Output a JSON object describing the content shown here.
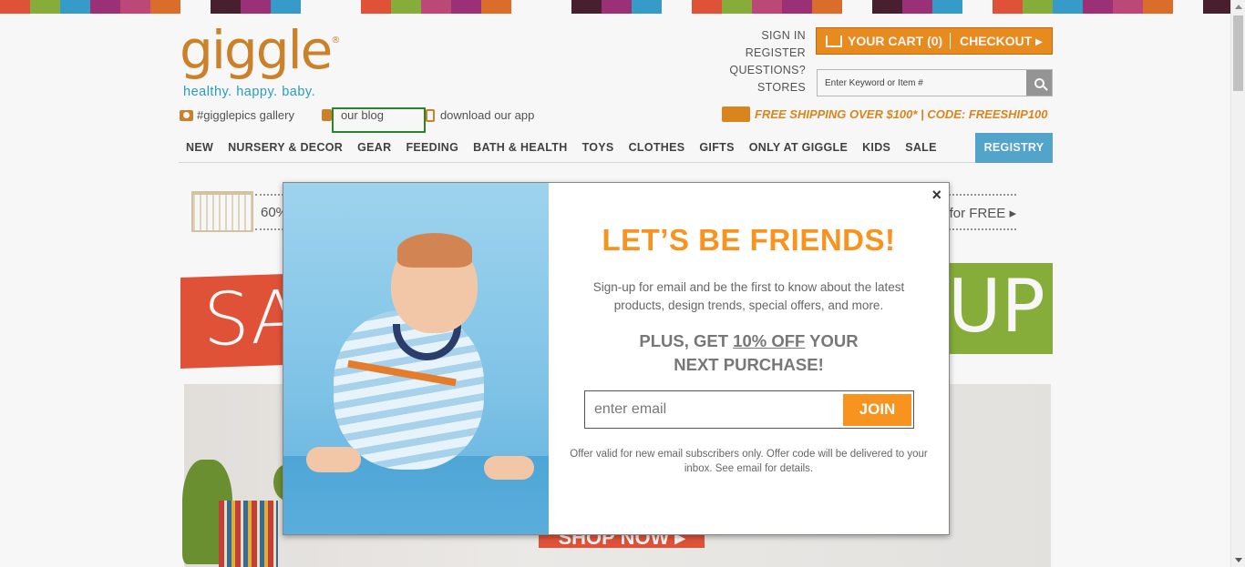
{
  "stripe_colors": [
    "#e8553a",
    "#8bb33b",
    "#38a0cf",
    "#a0327a",
    "#c24b7a",
    "#e0712b",
    "#fff",
    "#4a2030",
    "#a0327a",
    "#38a0cf",
    "#fff",
    "#fff",
    "#e8553a",
    "#8bb33b",
    "#c24b7a",
    "#a0327a",
    "#e0712b",
    "#fff",
    "#fff",
    "#4a2030",
    "#a0327a",
    "#38a0cf",
    "#fff",
    "#e8553a",
    "#8bb33b",
    "#c24b7a",
    "#a0327a",
    "#e0712b",
    "#fff",
    "#4a2030",
    "#a0327a",
    "#38a0cf",
    "#fff",
    "#e8553a",
    "#8bb33b",
    "#38a0cf",
    "#a0327a",
    "#c24b7a",
    "#e0712b",
    "#fff",
    "#4a2030"
  ],
  "logo": {
    "text": "giggle",
    "mark": "®",
    "tagline": "healthy. happy. baby."
  },
  "sublinks": [
    {
      "label": "#gigglepics gallery",
      "icon": "camera-icon"
    },
    {
      "label": "our blog",
      "icon": "pencil-icon"
    },
    {
      "label": "download our app",
      "icon": "phone-icon"
    }
  ],
  "toplinks": [
    "SIGN IN",
    "REGISTER",
    "QUESTIONS?",
    "STORES"
  ],
  "cart": {
    "label": "YOUR CART (0)",
    "checkout": "CHECKOUT ▸"
  },
  "search": {
    "placeholder": "Enter Keyword or Item #"
  },
  "shipping": "FREE SHIPPING OVER $100* | CODE: FREESHIP100",
  "nav": [
    "NEW",
    "NURSERY & DECOR",
    "GEAR",
    "FEEDING",
    "BATH & HEALTH",
    "TOYS",
    "CLOTHES",
    "GIFTS",
    "ONLY AT GIGGLE",
    "KIDS",
    "SALE"
  ],
  "nav_registry": "REGISTRY",
  "promo": {
    "left": "60%",
    "right": "for FREE ▸"
  },
  "hero": {
    "left_text": "SA",
    "right_text": "UP!",
    "shop_now": "SHOP NOW ▸"
  },
  "modal": {
    "close": "×",
    "headline": "LET’S BE FRIENDS!",
    "description": "Sign-up for email and be the first to know about the latest products, design trends, special offers, and more.",
    "offer_prefix": "PLUS, GET ",
    "offer_discount": "10% OFF",
    "offer_suffix": " YOUR",
    "offer_line2": "NEXT PURCHASE!",
    "email_placeholder": "enter email",
    "join_label": "JOIN",
    "fine_print": "Offer valid for new email subscribers only. Offer code will be delivered to your inbox. See email for details."
  }
}
